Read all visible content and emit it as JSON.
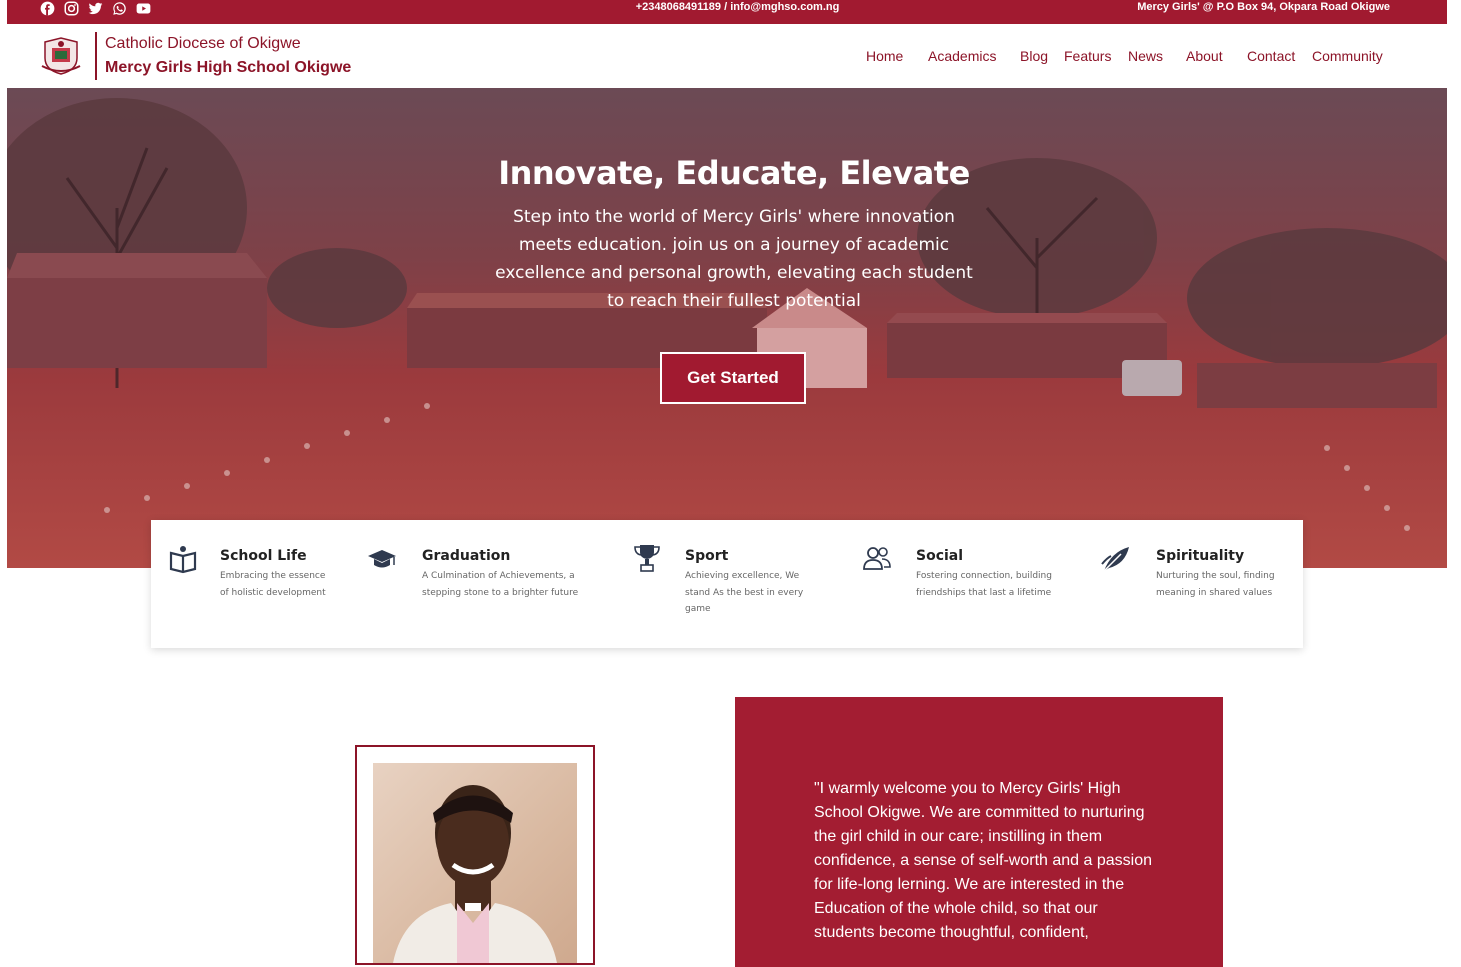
{
  "topbar": {
    "contact": "+2348068491189 / info@mghso.com.ng",
    "address": "Mercy Girls' @ P.O Box 94, Okpara Road Okigwe",
    "social_icons": [
      "facebook-icon",
      "instagram-icon",
      "twitter-icon",
      "whatsapp-icon",
      "youtube-icon"
    ]
  },
  "header": {
    "diocese": "Catholic Diocese of Okigwe",
    "school": "Mercy Girls High School Okigwe",
    "nav": [
      "Home",
      "Academics",
      "Blog",
      "Featurs",
      "News",
      "About",
      "Contact",
      "Community"
    ]
  },
  "hero": {
    "title": "Innovate, Educate, Elevate",
    "subtitle": "Step into the world of Mercy Girls' where innovation meets education. join us on a journey of academic excellence and personal growth, elevating each student to reach their fullest potential",
    "cta": "Get Started"
  },
  "features": [
    {
      "title": "School Life",
      "desc": "Embracing the essence of holistic development",
      "icon": "book-icon"
    },
    {
      "title": "Graduation",
      "desc": "A Culmination of Achievements, a stepping stone to a brighter future",
      "icon": "graduation-cap-icon"
    },
    {
      "title": "Sport",
      "desc": "Achieving excellence, We stand As the best in every game",
      "icon": "trophy-icon"
    },
    {
      "title": "Social",
      "desc": "Fostering connection, building friendships that last a lifetime",
      "icon": "people-icon"
    },
    {
      "title": "Spirituality",
      "desc": "Nurturing the soul, finding meaning in shared values",
      "icon": "feather-icon"
    }
  ],
  "welcome": {
    "quote": "\"I warmly welcome you to Mercy Girls' High School Okigwe. We are committed to nurturing the girl child in our care; instilling in them confidence, a sense of self-worth and a passion for life-long lerning. We are interested in the Education of the whole child, so that our students become thoughtful, confident,"
  },
  "colors": {
    "brand": "#a11a30",
    "text_dark": "#222222"
  }
}
